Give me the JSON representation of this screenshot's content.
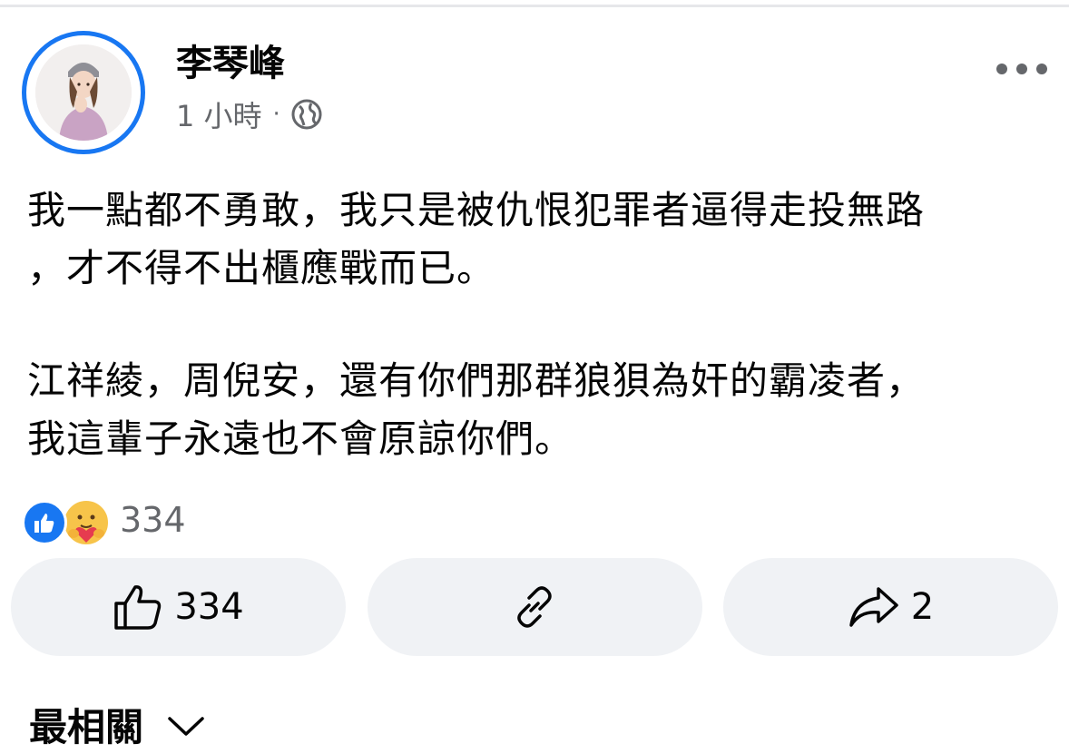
{
  "post": {
    "author_name": "李琴峰",
    "timestamp": "1 小時",
    "separator": "·",
    "audience_icon": "globe-icon",
    "more_icon": "more-horizontal-icon",
    "body_lines_p1": [
      "我一點都不勇敢，我只是被仇恨犯罪者逼得走投無路",
      "，才不得不出櫃應戰而已。"
    ],
    "body_lines_p2": [
      "江祥綾，周倪安，還有你們那群狼狽為奸的霸凌者，",
      "我這輩子永遠也不會原諒你們。"
    ]
  },
  "reactions": {
    "icons": [
      "like-reaction-icon",
      "care-reaction-icon"
    ],
    "count": "334"
  },
  "actions": {
    "like_count": "334",
    "link_icon": "link-icon",
    "share_count": "2"
  },
  "comments": {
    "sort_label": "最相關"
  },
  "colors": {
    "accent": "#1877f2",
    "secondary_text": "#65676b",
    "button_bg": "#f0f2f5"
  }
}
